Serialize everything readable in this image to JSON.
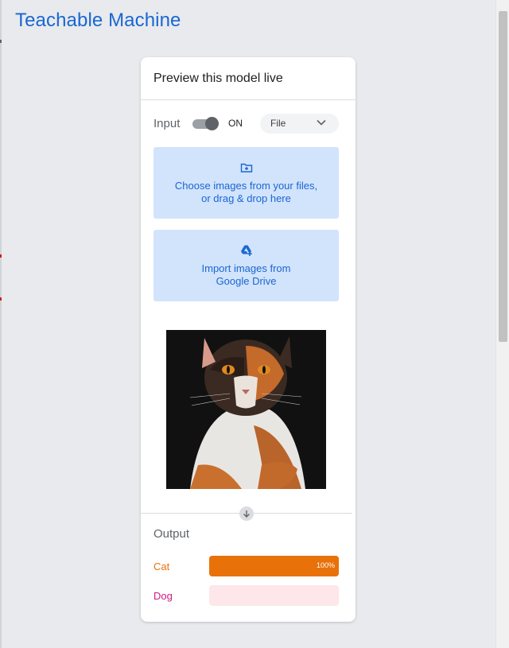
{
  "app": {
    "title": "Teachable Machine"
  },
  "card": {
    "title": "Preview this model live"
  },
  "input": {
    "label": "Input",
    "toggle_state": "ON",
    "source_selected": "File"
  },
  "upload": {
    "files_line1": "Choose images from your files,",
    "files_line2": "or drag & drop here",
    "drive_line1": "Import images from",
    "drive_line2": "Google Drive"
  },
  "output": {
    "title": "Output",
    "classes": [
      {
        "name": "Cat",
        "confidence": 1.0,
        "percent_label": "100%",
        "color": "#e8710a",
        "track": "#e8710a"
      },
      {
        "name": "Dog",
        "confidence": 0.0,
        "percent_label": "",
        "color": "#d01884",
        "track": "#fde7ea"
      }
    ]
  },
  "colors": {
    "accent": "#1967d2",
    "upload_bg": "#d2e3fc",
    "page_bg": "#e8eaed"
  },
  "icons": {
    "dropdown": "chevron-down-icon",
    "files": "folder-add-icon",
    "drive": "google-drive-add-icon",
    "divider_arrow": "arrow-down-icon"
  }
}
